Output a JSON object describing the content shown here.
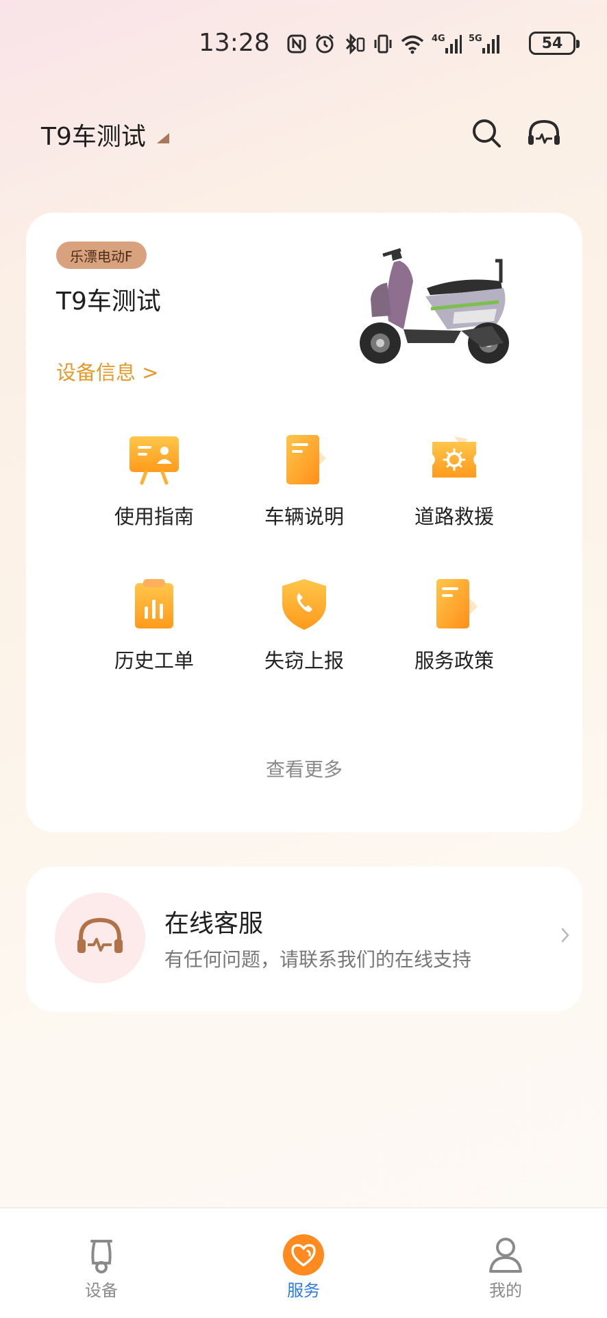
{
  "status_bar": {
    "time": "13:28",
    "network_4g": "4G",
    "network_5g": "5G",
    "battery": "54"
  },
  "header": {
    "vehicle_name": "T9车测试"
  },
  "device_card": {
    "brand_badge": "乐漂电动F",
    "device_name": "T9车测试",
    "device_info_link": "设备信息 >",
    "features": [
      {
        "label": "使用指南",
        "icon": "presentation-icon"
      },
      {
        "label": "车辆说明",
        "icon": "document-icon"
      },
      {
        "label": "道路救援",
        "icon": "rescue-ticket-icon"
      },
      {
        "label": "历史工单",
        "icon": "clipboard-chart-icon"
      },
      {
        "label": "失窃上报",
        "icon": "shield-phone-icon"
      },
      {
        "label": "服务政策",
        "icon": "policy-document-icon"
      }
    ],
    "more_link": "查看更多"
  },
  "support": {
    "title": "在线客服",
    "subtitle": "有任何问题，请联系我们的在线支持",
    "icon": "headset-icon"
  },
  "tabbar": {
    "tabs": [
      {
        "label": "设备",
        "icon": "scooter-icon",
        "active": false
      },
      {
        "label": "服务",
        "icon": "heart-icon",
        "active": true
      },
      {
        "label": "我的",
        "icon": "person-icon",
        "active": false
      }
    ]
  },
  "colors": {
    "accent_orange": "#e39a2a",
    "active_tab": "#2a7be4",
    "tab_orange": "#ff8a1f",
    "badge": "#d9a27e"
  }
}
